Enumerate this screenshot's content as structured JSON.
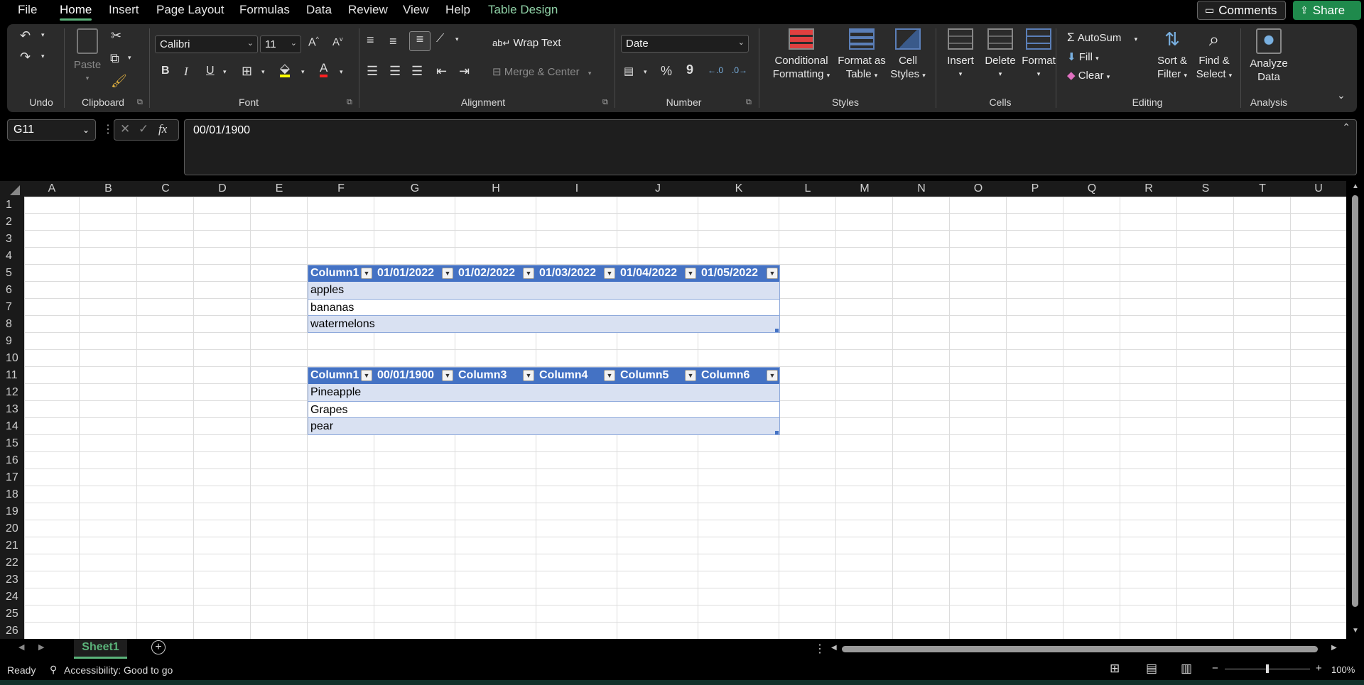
{
  "menu": {
    "items": [
      "File",
      "Home",
      "Insert",
      "Page Layout",
      "Formulas",
      "Data",
      "Review",
      "View",
      "Help",
      "Table Design"
    ],
    "active": "Home",
    "comments_label": "Comments",
    "share_label": "Share"
  },
  "ribbon": {
    "groups": {
      "undo": "Undo",
      "clipboard": "Clipboard",
      "font": "Font",
      "alignment": "Alignment",
      "number": "Number",
      "styles": "Styles",
      "cells": "Cells",
      "editing": "Editing",
      "analysis": "Analysis"
    },
    "paste_label": "Paste",
    "font_name": "Calibri",
    "font_size": "11",
    "wrap_text": "Wrap Text",
    "merge_center": "Merge & Center",
    "number_format": "Date",
    "conditional_formatting": [
      "Conditional",
      "Formatting"
    ],
    "format_as_table": [
      "Format as",
      "Table"
    ],
    "cell_styles": [
      "Cell",
      "Styles"
    ],
    "insert": "Insert",
    "delete": "Delete",
    "format": "Format",
    "autosum": "AutoSum",
    "fill": "Fill",
    "clear": "Clear",
    "sort_filter": [
      "Sort &",
      "Filter"
    ],
    "find_select": [
      "Find &",
      "Select"
    ],
    "analyze_data": [
      "Analyze",
      "Data"
    ],
    "bold": "B",
    "italic": "I",
    "underline": "U",
    "font_color_letter": "A",
    "percent": "%",
    "comma": "9"
  },
  "formula_bar": {
    "name_box": "G11",
    "formula": "00/01/1900",
    "fx": "fx"
  },
  "columns": [
    "A",
    "B",
    "C",
    "D",
    "E",
    "F",
    "G",
    "H",
    "I",
    "J",
    "K",
    "L",
    "M",
    "N",
    "O",
    "P",
    "Q",
    "R",
    "S",
    "T",
    "U"
  ],
  "rows": [
    "1",
    "2",
    "3",
    "4",
    "5",
    "6",
    "7",
    "8",
    "9",
    "10",
    "11",
    "12",
    "13",
    "14",
    "15",
    "16",
    "17",
    "18",
    "19",
    "20",
    "21",
    "22",
    "23",
    "24",
    "25",
    "26"
  ],
  "table1": {
    "headers": [
      "Column1",
      "01/01/2022",
      "01/02/2022",
      "01/03/2022",
      "01/04/2022",
      "01/05/2022"
    ],
    "rows": [
      "apples",
      "bananas",
      "watermelons"
    ]
  },
  "table2": {
    "headers": [
      "Column1",
      "00/01/1900",
      "Column3",
      "Column4",
      "Column5",
      "Column6"
    ],
    "rows": [
      "Pineapple",
      "Grapes",
      "pear"
    ]
  },
  "sheet_tab": "Sheet1",
  "status": {
    "ready": "Ready",
    "accessibility": "Accessibility: Good to go",
    "zoom": "100%"
  },
  "colors": {
    "accent": "#5bb37a",
    "table_header": "#4472c4",
    "table_band": "#d9e1f2",
    "share_button": "#1f8a4c"
  }
}
